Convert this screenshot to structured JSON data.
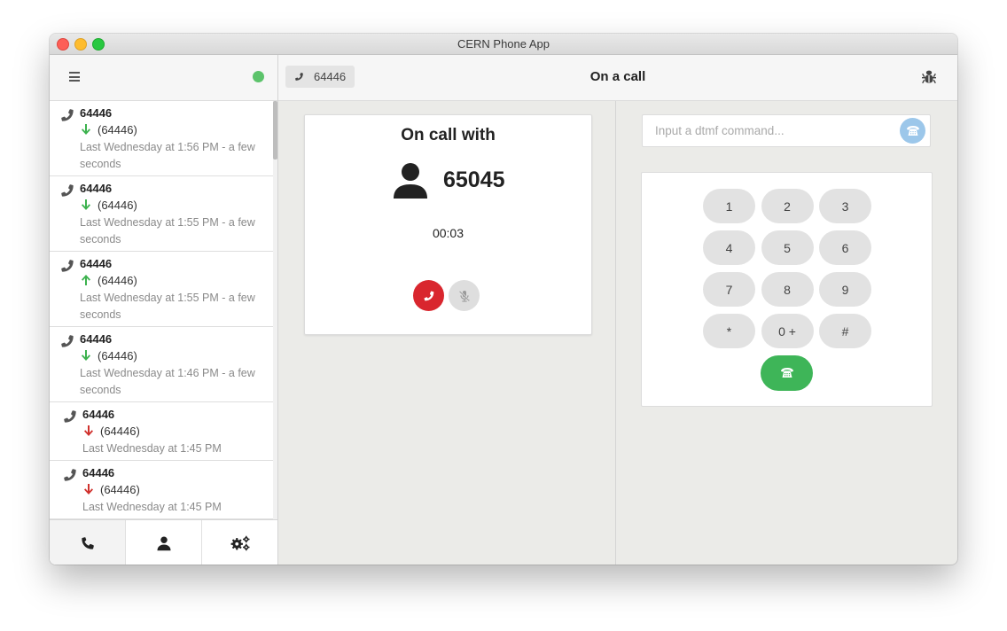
{
  "window": {
    "title": "CERN Phone App"
  },
  "sidebar": {
    "status": "online",
    "calls": [
      {
        "number": "64446",
        "direction": "incoming",
        "alias": "(64446)",
        "time": "Last Wednesday at 1:56 PM - a few seconds"
      },
      {
        "number": "64446",
        "direction": "incoming",
        "alias": "(64446)",
        "time": "Last Wednesday at 1:55 PM - a few seconds"
      },
      {
        "number": "64446",
        "direction": "outgoing",
        "alias": "(64446)",
        "time": "Last Wednesday at 1:55 PM - a few seconds"
      },
      {
        "number": "64446",
        "direction": "incoming",
        "alias": "(64446)",
        "time": "Last Wednesday at 1:46 PM - a few seconds"
      },
      {
        "number": "64446",
        "direction": "missed",
        "alias": "(64446)",
        "time": "Last Wednesday at 1:45 PM"
      },
      {
        "number": "64446",
        "direction": "missed",
        "alias": "(64446)",
        "time": "Last Wednesday at 1:45 PM"
      }
    ],
    "tabs": [
      {
        "icon": "phone-icon",
        "active": true
      },
      {
        "icon": "user-icon",
        "active": false
      },
      {
        "icon": "settings-icon",
        "active": false
      }
    ]
  },
  "topbar": {
    "current_number": "64446",
    "title": "On a call"
  },
  "call": {
    "heading": "On call with",
    "number": "65045",
    "timer": "00:03"
  },
  "dtmf": {
    "placeholder": "Input a dtmf command...",
    "keys": [
      "1",
      "2",
      "3",
      "4",
      "5",
      "6",
      "7",
      "8",
      "9",
      "*",
      "0 +",
      "#"
    ]
  },
  "colors": {
    "accent_green": "#3eb558",
    "hangup_red": "#d9262e",
    "incoming_arrow": "#3cb24e",
    "outgoing_arrow": "#3cb24e",
    "missed_arrow": "#d0312d",
    "status_online": "#5cc36b"
  }
}
